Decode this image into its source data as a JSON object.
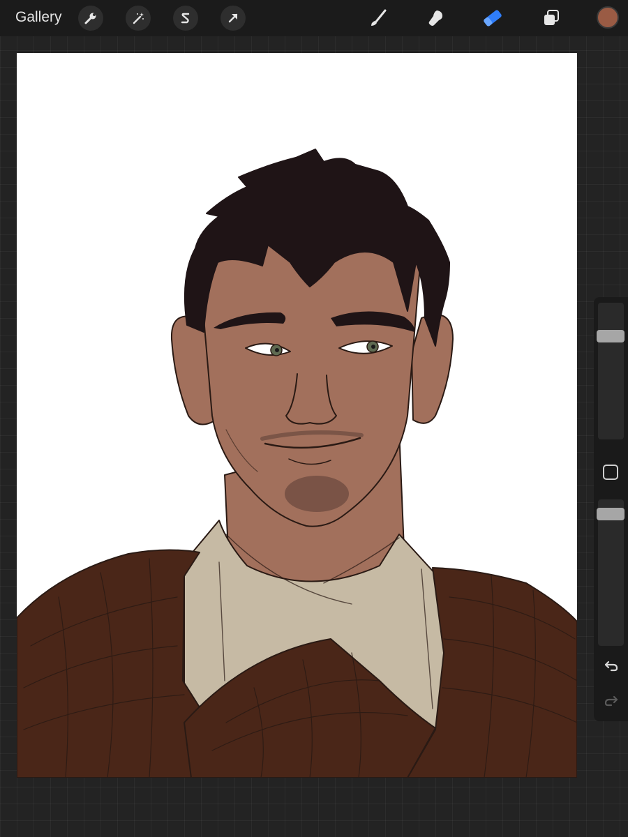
{
  "toolbar": {
    "gallery_label": "Gallery",
    "left_tools": [
      {
        "name": "actions",
        "icon": "wrench-icon"
      },
      {
        "name": "adjustments",
        "icon": "magic-wand-icon"
      },
      {
        "name": "selection",
        "icon": "selection-s-icon"
      },
      {
        "name": "transform",
        "icon": "arrow-cursor-icon"
      }
    ],
    "right_tools": [
      {
        "name": "brush",
        "icon": "brush-icon"
      },
      {
        "name": "smudge",
        "icon": "smudge-icon"
      },
      {
        "name": "eraser",
        "icon": "eraser-icon",
        "active": true
      },
      {
        "name": "layers",
        "icon": "layers-icon"
      }
    ],
    "active_tool": "eraser",
    "active_color": "#9a5b44",
    "accent_color": "#2f7dfa"
  },
  "sidebar": {
    "brush_size_level": 0.78,
    "brush_opacity_level": 0.94,
    "modifier_icon": "square-modifier-icon",
    "undo_icon": "undo-icon",
    "redo_icon": "redo-icon",
    "redo_enabled": false
  },
  "canvas": {
    "background": "#ffffff",
    "artwork": "portrait-illustration",
    "colors": {
      "skin": "#a2705c",
      "hair": "#1f1416",
      "shirt": "#c6baa4",
      "robe": "#4a2618",
      "line": "#2a1a14",
      "eye": "#5f6b52"
    }
  }
}
